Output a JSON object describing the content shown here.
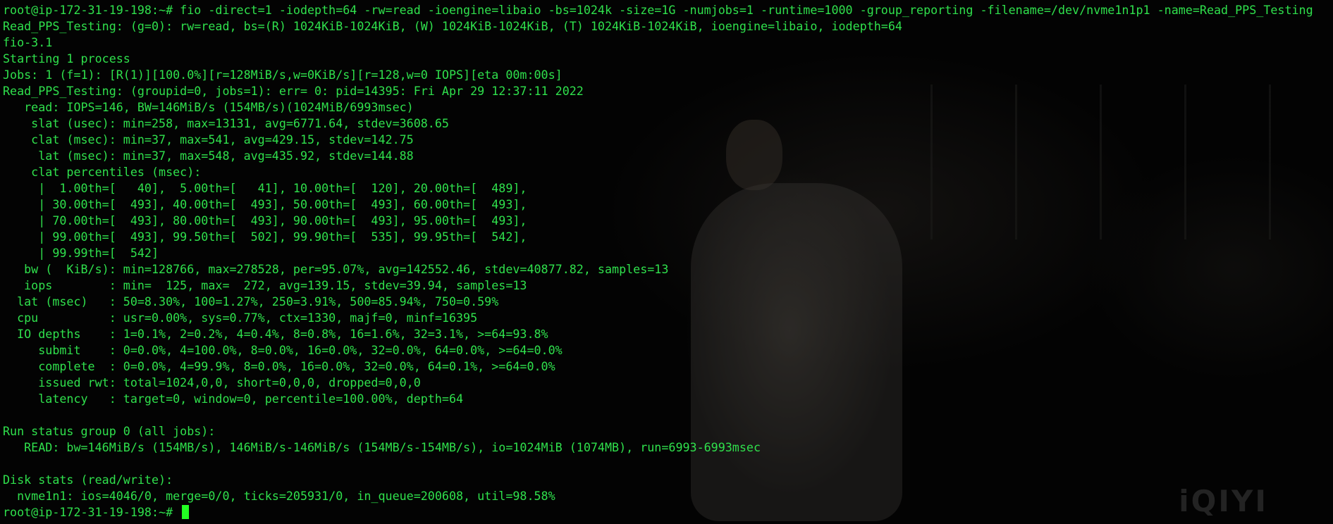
{
  "terminal": {
    "lines": [
      "root@ip-172-31-19-198:~# fio -direct=1 -iodepth=64 -rw=read -ioengine=libaio -bs=1024k -size=1G -numjobs=1 -runtime=1000 -group_reporting -filename=/dev/nvme1n1p1 -name=Read_PPS_Testing",
      "Read_PPS_Testing: (g=0): rw=read, bs=(R) 1024KiB-1024KiB, (W) 1024KiB-1024KiB, (T) 1024KiB-1024KiB, ioengine=libaio, iodepth=64",
      "fio-3.1",
      "Starting 1 process",
      "Jobs: 1 (f=1): [R(1)][100.0%][r=128MiB/s,w=0KiB/s][r=128,w=0 IOPS][eta 00m:00s]",
      "Read_PPS_Testing: (groupid=0, jobs=1): err= 0: pid=14395: Fri Apr 29 12:37:11 2022",
      "   read: IOPS=146, BW=146MiB/s (154MB/s)(1024MiB/6993msec)",
      "    slat (usec): min=258, max=13131, avg=6771.64, stdev=3608.65",
      "    clat (msec): min=37, max=541, avg=429.15, stdev=142.75",
      "     lat (msec): min=37, max=548, avg=435.92, stdev=144.88",
      "    clat percentiles (msec):",
      "     |  1.00th=[   40],  5.00th=[   41], 10.00th=[  120], 20.00th=[  489],",
      "     | 30.00th=[  493], 40.00th=[  493], 50.00th=[  493], 60.00th=[  493],",
      "     | 70.00th=[  493], 80.00th=[  493], 90.00th=[  493], 95.00th=[  493],",
      "     | 99.00th=[  493], 99.50th=[  502], 99.90th=[  535], 99.95th=[  542],",
      "     | 99.99th=[  542]",
      "   bw (  KiB/s): min=128766, max=278528, per=95.07%, avg=142552.46, stdev=40877.82, samples=13",
      "   iops        : min=  125, max=  272, avg=139.15, stdev=39.94, samples=13",
      "  lat (msec)   : 50=8.30%, 100=1.27%, 250=3.91%, 500=85.94%, 750=0.59%",
      "  cpu          : usr=0.00%, sys=0.77%, ctx=1330, majf=0, minf=16395",
      "  IO depths    : 1=0.1%, 2=0.2%, 4=0.4%, 8=0.8%, 16=1.6%, 32=3.1%, >=64=93.8%",
      "     submit    : 0=0.0%, 4=100.0%, 8=0.0%, 16=0.0%, 32=0.0%, 64=0.0%, >=64=0.0%",
      "     complete  : 0=0.0%, 4=99.9%, 8=0.0%, 16=0.0%, 32=0.0%, 64=0.1%, >=64=0.0%",
      "     issued rwt: total=1024,0,0, short=0,0,0, dropped=0,0,0",
      "     latency   : target=0, window=0, percentile=100.00%, depth=64",
      "",
      "Run status group 0 (all jobs):",
      "   READ: bw=146MiB/s (154MB/s), 146MiB/s-146MiB/s (154MB/s-154MB/s), io=1024MiB (1074MB), run=6993-6993msec",
      "",
      "Disk stats (read/write):",
      "  nvme1n1: ios=4046/0, merge=0/0, ticks=205931/0, in_queue=200608, util=98.58%"
    ],
    "prompt": "root@ip-172-31-19-198:~# ",
    "text_color": "#2fe04c",
    "cursor_color": "#22ff22",
    "background_color": "#000000"
  },
  "watermark": {
    "text": "iQIYI"
  }
}
